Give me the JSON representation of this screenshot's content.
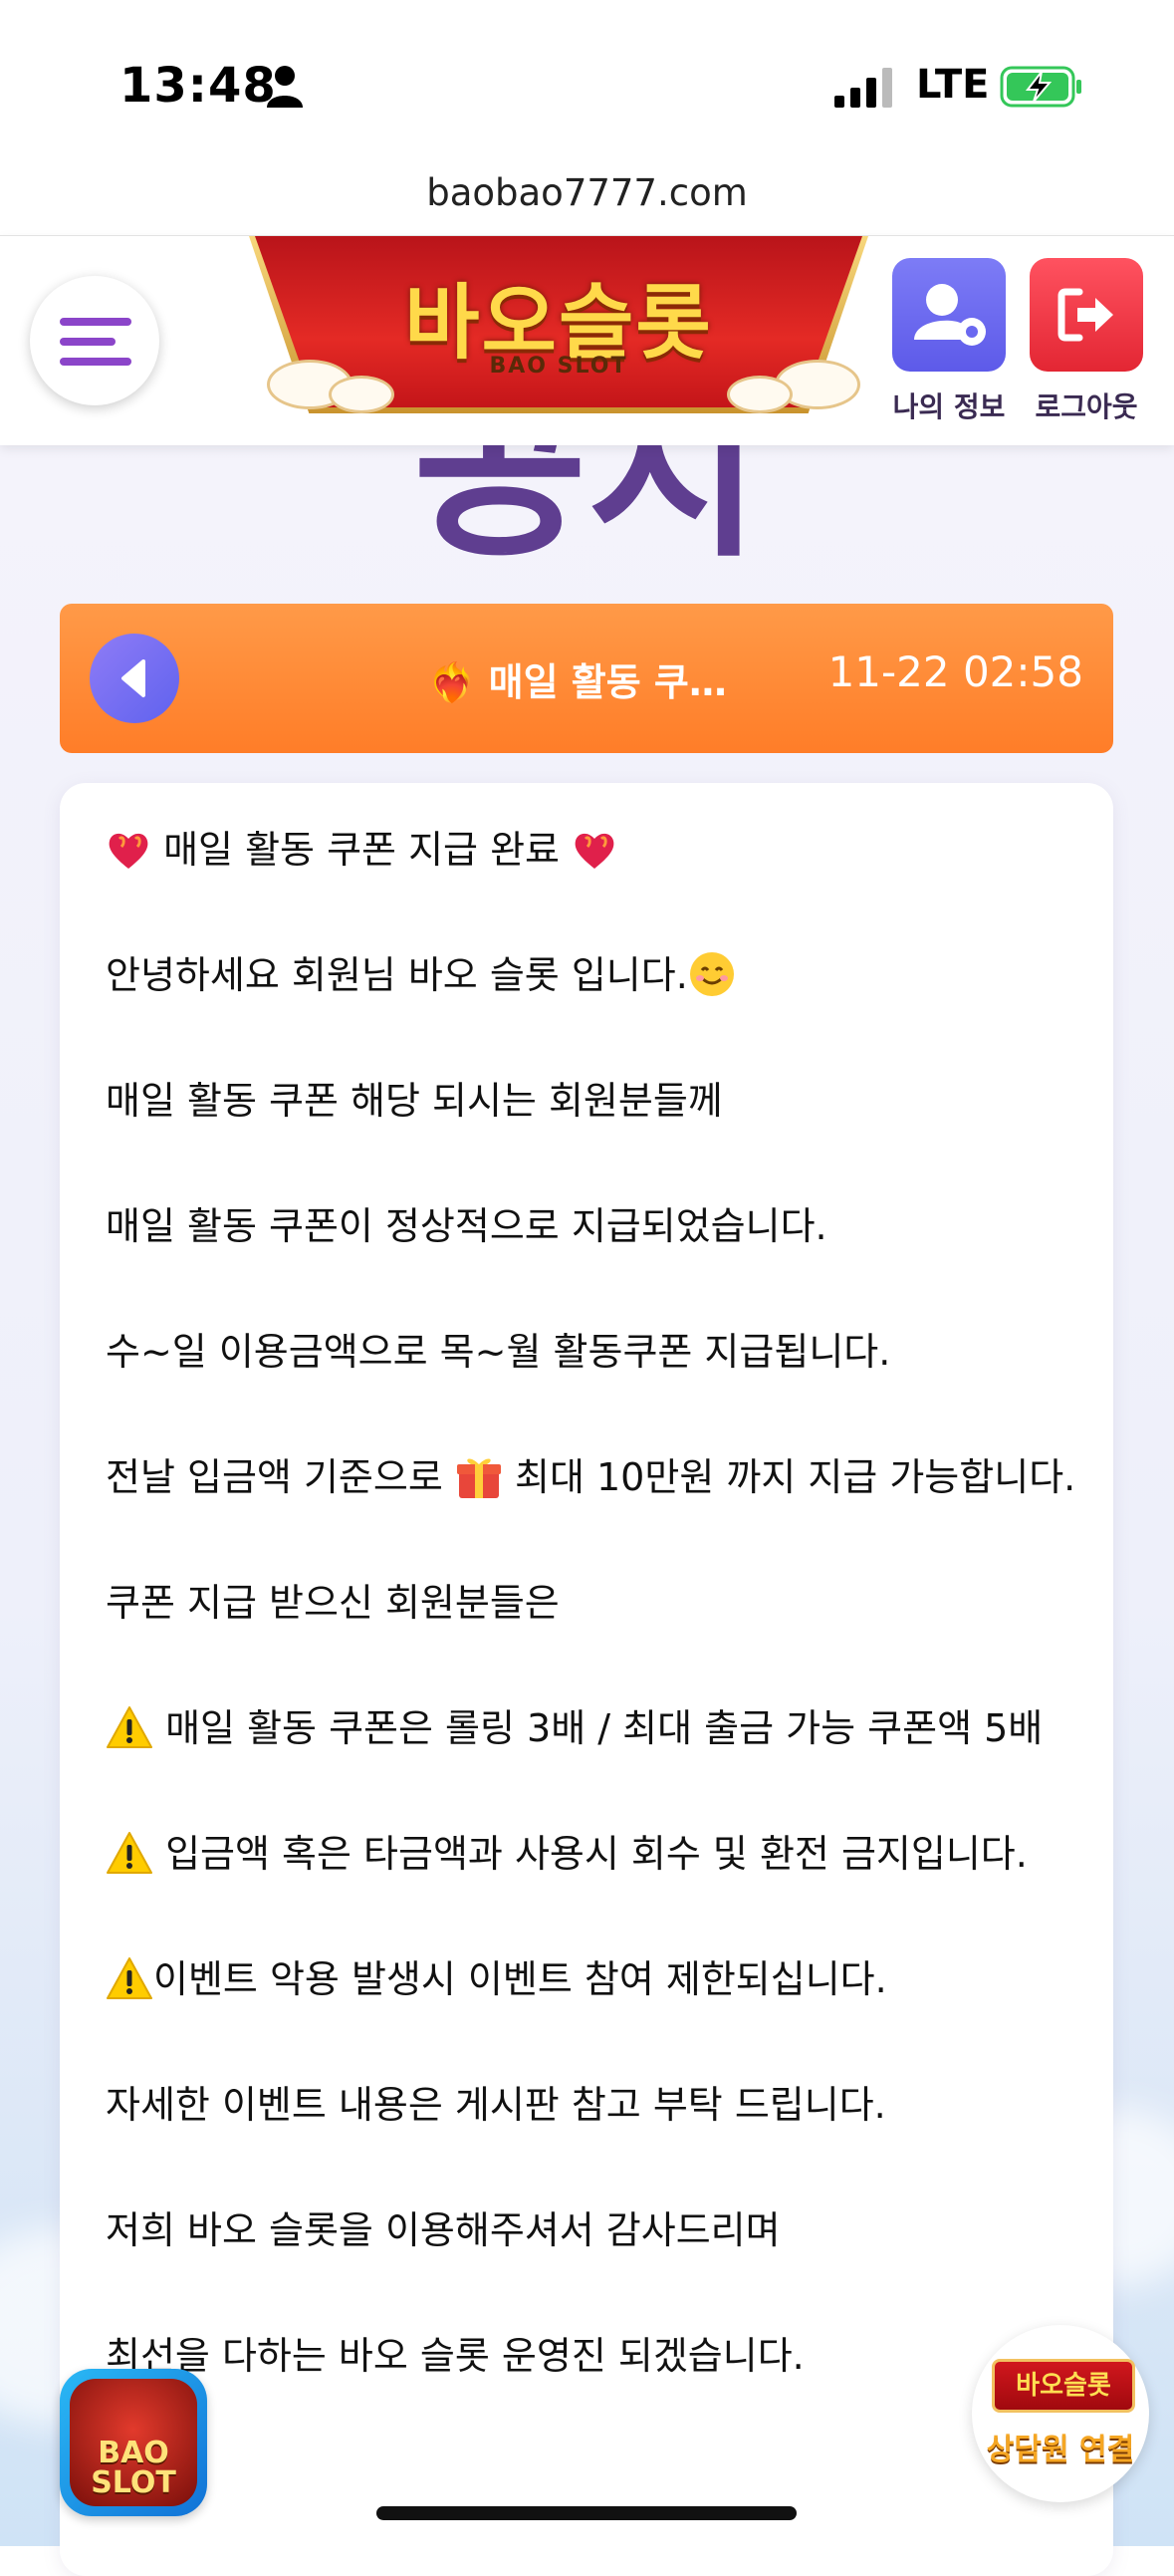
{
  "status_bar": {
    "time": "13:48",
    "network": "LTE",
    "battery_state": "charging"
  },
  "browser": {
    "url": "baobao7777.com"
  },
  "header": {
    "logo_title": "바오슬롯",
    "logo_subtitle": "BAO SLOT",
    "my_info_label": "나의 정보",
    "logout_label": "로그아웃"
  },
  "page": {
    "heading": "공지"
  },
  "notice": {
    "title": "❤️‍🔥 매일 활동 쿠…",
    "date": "11-22 02:58"
  },
  "content": {
    "line1": "매일 활동 쿠폰 지급 완료",
    "line2": "안녕하세요 회원님 바오 슬롯 입니다.",
    "line3": "매일 활동 쿠폰 해당 되시는 회원분들께",
    "line4": "매일 활동 쿠폰이 정상적으로 지급되었습니다.",
    "line5": "수~일 이용금액으로 목~월 활동쿠폰 지급됩니다.",
    "line6a": "전날 입금액 기준으로",
    "line6b": "최대 10만원 까지 지급 가능합니다.",
    "line7": "쿠폰 지급 받으신 회원분들은",
    "line8": "매일 활동 쿠폰은 롤링 3배 / 최대 출금 가능 쿠폰액 5배",
    "line9": "입금액 혹은 타금액과 사용시 회수 및 환전 금지입니다.",
    "line10": "이벤트 악용 발생시 이벤트 참여 제한되십니다.",
    "line11": "자세한 이벤트 내용은 게시판 참고 부탁 드립니다.",
    "line12": "저희 바오 슬롯을 이용해주셔서 감사드리며",
    "line13": "최선을 다하는 바오 슬롯 운영진 되겠습니다."
  },
  "floating": {
    "app_badge_text": "BAO SLOT",
    "chat_logo_text": "바오슬롯",
    "chat_label": "상담원 연결"
  },
  "colors": {
    "accent_purple": "#8b45c9",
    "notice_orange": "#ff8a35",
    "logout_red": "#e32633",
    "info_blue": "#6a68f0"
  }
}
